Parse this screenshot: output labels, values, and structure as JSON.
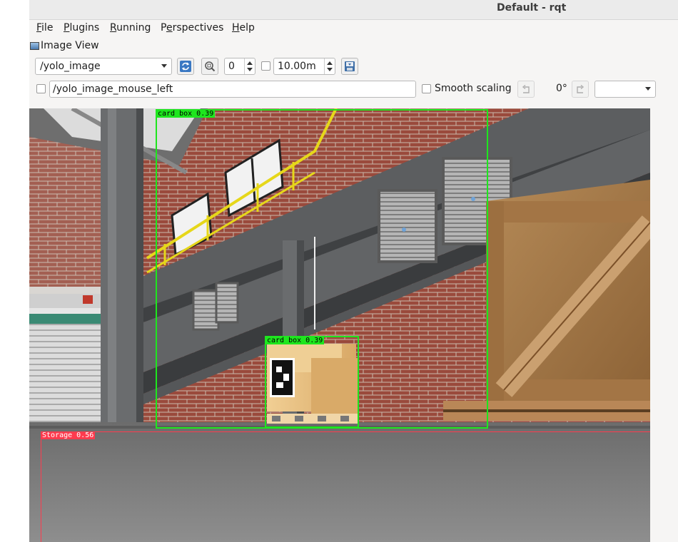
{
  "window": {
    "title": "Default - rqt"
  },
  "menu": [
    {
      "mnemonic": "F",
      "rest": "ile"
    },
    {
      "mnemonic": "P",
      "rest": "lugins"
    },
    {
      "mnemonic": "R",
      "rest": "unning"
    },
    {
      "pre": "P",
      "mnemonic": "e",
      "rest": "rspectives"
    },
    {
      "mnemonic": "H",
      "rest": "elp"
    }
  ],
  "plugin": {
    "title": "Image View"
  },
  "toolbar": {
    "topic": "/yolo_image",
    "zoom_value": "0",
    "duration_value": "10.00m",
    "mouse_topic": "/yolo_image_mouse_left",
    "smooth_label": "Smooth scaling",
    "rotation": "0°",
    "rotate_select_value": ""
  },
  "detections": [
    {
      "label": "card box 0.39",
      "color": "#1ee61e"
    },
    {
      "label": "card box 0.39",
      "color": "#1ee61e"
    },
    {
      "label": "Storage 0.56",
      "color": "#ff3b4e"
    }
  ],
  "colors": {
    "brick": "#9a4a3c",
    "floor": "#7d7d7d",
    "beam": "#5c5e60",
    "crate": "#b9844e",
    "railing": "#e6d71a"
  }
}
